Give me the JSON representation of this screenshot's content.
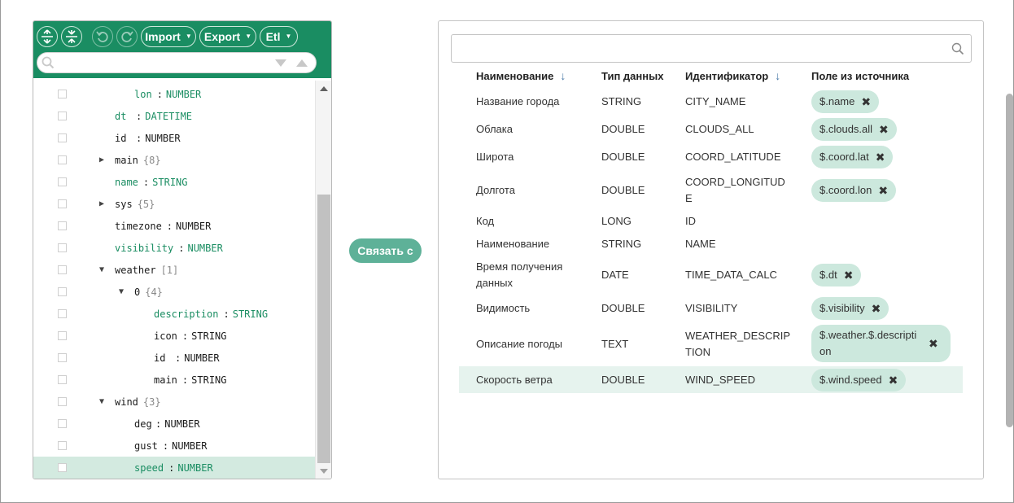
{
  "toolbar": {
    "import_label": "Import",
    "export_label": "Export",
    "etl_label": "Etl"
  },
  "tree": {
    "rows": [
      {
        "key": "lon",
        "type": "NUMBER",
        "green": true
      },
      {
        "key": "dt",
        "type": "DATETIME",
        "green": true
      },
      {
        "key": "id",
        "type": "NUMBER",
        "green": false
      },
      {
        "key": "main",
        "count": "{8}"
      },
      {
        "key": "name",
        "type": "STRING",
        "green": true
      },
      {
        "key": "sys",
        "count": "{5}"
      },
      {
        "key": "timezone",
        "type": "NUMBER",
        "green": false
      },
      {
        "key": "visibility",
        "type": "NUMBER",
        "green": true
      },
      {
        "key": "weather",
        "count": "[1]"
      },
      {
        "key": "0",
        "count": "{4}"
      },
      {
        "key": "description",
        "type": "STRING",
        "green": true
      },
      {
        "key": "icon",
        "type": "STRING",
        "green": false
      },
      {
        "key": "id",
        "type": "NUMBER",
        "green": false
      },
      {
        "key": "main",
        "type": "STRING",
        "green": false
      },
      {
        "key": "wind",
        "count": "{3}"
      },
      {
        "key": "deg",
        "type": "NUMBER",
        "green": false
      },
      {
        "key": "gust",
        "type": "NUMBER",
        "green": false
      },
      {
        "key": "speed",
        "type": "NUMBER",
        "green": true
      }
    ]
  },
  "bind_button_label": "Связать с",
  "mapping": {
    "search_placeholder": "",
    "headers": {
      "name": "Наименование",
      "dtype": "Тип данных",
      "ident": "Идентификатор",
      "source": "Поле из источника"
    },
    "rows": [
      {
        "name": "Название города",
        "dtype": "STRING",
        "ident": "CITY_NAME",
        "source": "$.name"
      },
      {
        "name": "Облака",
        "dtype": "DOUBLE",
        "ident": "CLOUDS_ALL",
        "source": "$.clouds.all"
      },
      {
        "name": "Широта",
        "dtype": "DOUBLE",
        "ident": "COORD_LATITUDE",
        "source": "$.coord.lat"
      },
      {
        "name": "Долгота",
        "dtype": "DOUBLE",
        "ident": "COORD_LONGITUDE",
        "source": "$.coord.lon"
      },
      {
        "name": "Код",
        "dtype": "LONG",
        "ident": "ID",
        "source": ""
      },
      {
        "name": "Наименование",
        "dtype": "STRING",
        "ident": "NAME",
        "source": ""
      },
      {
        "name": "Время получения данных",
        "dtype": "DATE",
        "ident": "TIME_DATA_CALC",
        "source": "$.dt"
      },
      {
        "name": "Видимость",
        "dtype": "DOUBLE",
        "ident": "VISIBILITY",
        "source": "$.visibility"
      },
      {
        "name": "Описание погоды",
        "dtype": "TEXT",
        "ident": "WEATHER_DESCRIPTION",
        "source": "$.weather.$.description"
      },
      {
        "name": "Скорость ветра",
        "dtype": "DOUBLE",
        "ident": "WIND_SPEED",
        "source": "$.wind.speed"
      }
    ],
    "remove_glyph": "✖"
  },
  "colors": {
    "accent": "#1a8d62",
    "chip": "#cce8dd",
    "button": "#5eb198",
    "selected_row": "#e6f3ee"
  }
}
